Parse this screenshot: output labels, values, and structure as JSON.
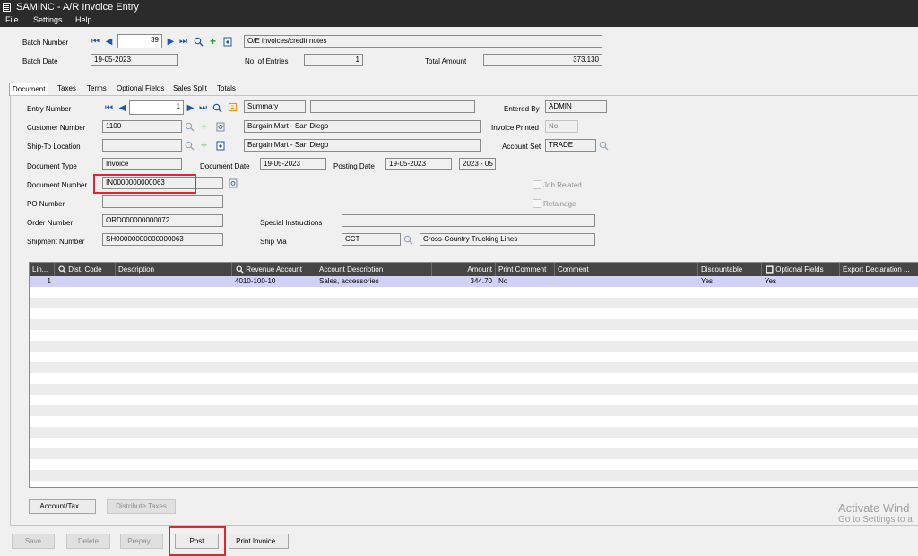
{
  "window": {
    "title": "SAMINC - A/R Invoice Entry"
  },
  "menu": [
    "File",
    "Settings",
    "Help"
  ],
  "batch": {
    "number_label": "Batch Number",
    "number": "39",
    "description": "O/E invoices/credit notes",
    "date_label": "Batch Date",
    "date": "19-05-2023",
    "entries_label": "No. of Entries",
    "entries": "1",
    "total_label": "Total Amount",
    "total": "373.130"
  },
  "tabs": [
    "Document",
    "Taxes",
    "Terms",
    "Optional Fields",
    "Sales Split",
    "Totals"
  ],
  "entry": {
    "entry_number_label": "Entry Number",
    "entry_number": "1",
    "entry_type": "Summary",
    "entry_description": "",
    "entered_by_label": "Entered By",
    "entered_by": "ADMIN",
    "customer_number_label": "Customer Number",
    "customer_number": "1100",
    "customer_name": "Bargain Mart - San Diego",
    "invoice_printed_label": "Invoice Printed",
    "invoice_printed": "No",
    "ship_to_label": "Ship-To Location",
    "ship_to": "",
    "ship_to_name": "Bargain Mart - San Diego",
    "account_set_label": "Account Set",
    "account_set": "TRADE",
    "document_type_label": "Document Type",
    "document_type": "Invoice",
    "document_date_label": "Document Date",
    "document_date": "19-05-2023",
    "posting_date_label": "Posting Date",
    "posting_date": "19-05-2023",
    "period": "2023 - 05",
    "document_number_label": "Document Number",
    "document_number": "IN0000000000063",
    "job_related_label": "Job Related",
    "po_number_label": "PO Number",
    "po_number": "",
    "retainage_label": "Retainage",
    "order_number_label": "Order Number",
    "order_number": "ORD000000000072",
    "special_instructions_label": "Special Instructions",
    "special_instructions": "",
    "shipment_number_label": "Shipment Number",
    "shipment_number": "SH00000000000000063",
    "ship_via_label": "Ship Via",
    "ship_via": "CCT",
    "ship_via_name": "Cross-Country Trucking Lines"
  },
  "grid": {
    "columns": [
      "Lin...",
      "Dist. Code",
      "Description",
      "Revenue Account",
      "Account Description",
      "Amount",
      "Print Comment",
      "Comment",
      "Discountable",
      "Optional Fields",
      "Export Declaration ..."
    ],
    "rows": [
      [
        "1",
        "",
        "",
        "4010-100-10",
        "Sales, accessories",
        "344.70",
        "No",
        "",
        "Yes",
        "Yes",
        ""
      ]
    ]
  },
  "buttons": {
    "account_tax": "Account/Tax...",
    "distribute_taxes": "Distribute Taxes",
    "save": "Save",
    "delete": "Delete",
    "prepay": "Prepay...",
    "post": "Post",
    "print_invoice": "Print Invoice..."
  },
  "watermark": {
    "line1": "Activate Wind",
    "line2": "Go to Settings to a"
  },
  "icons": {
    "first": "first-record-icon",
    "previous": "previous-record-icon",
    "next": "next-record-icon",
    "last": "last-record-icon",
    "finder": "magnifier-icon",
    "new": "add-icon",
    "new_document": "new-document-icon",
    "zoom": "zoom-detail-icon"
  },
  "colors": {
    "highlight": "#e8242b",
    "selected_row": "#cfd2f5",
    "grid_header": "#454545"
  }
}
